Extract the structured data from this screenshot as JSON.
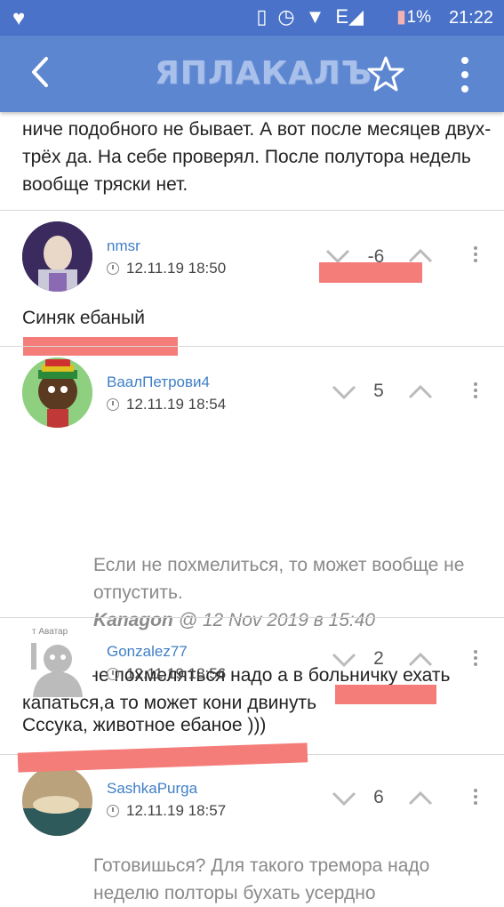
{
  "status_bar": {
    "battery_pct": "1%",
    "time": "21:22"
  },
  "app_bar": {
    "logo_text": "ЯПЛАКАЛЪ"
  },
  "previous_comment": {
    "text": "ниче подобного не бывает. А вот после месяцев двух-трёх да. На себе проверял. После полутора недель вообще тряски нет."
  },
  "comments": [
    {
      "username": "nmsr",
      "timestamp": "12.11.19 18:50",
      "rating": "-6",
      "text": "Синяк ебаный"
    },
    {
      "username": "ВаалПетрови4",
      "timestamp": "12.11.19 18:54",
      "rating": "5",
      "quote": {
        "text": "Если не похмелиться, то может вообще не отпустить.",
        "author": "Kanagon",
        "date": "@ 12 Nov 2019 в 15:40"
      },
      "text": "Да ему не похмеляться надо а в больничку ехать капаться,а то может кони двинуть"
    },
    {
      "username": "Gonzalez77",
      "avatar_caption": "т Аватар",
      "timestamp": "12.11.19 18:56",
      "rating": "2",
      "text": "Сссука, животное ебаное )))"
    },
    {
      "username": "SashkaPurga",
      "timestamp": "12.11.19 18:57",
      "rating": "6",
      "quote": {
        "text": "Готовишься? Для такого тремора надо неделю полторы бухать усердно"
      }
    }
  ],
  "colors": {
    "status_bar": "#4a72c8",
    "app_bar": "#5d86d1",
    "username": "#3f7fc6",
    "redaction": "#f47d7a"
  }
}
